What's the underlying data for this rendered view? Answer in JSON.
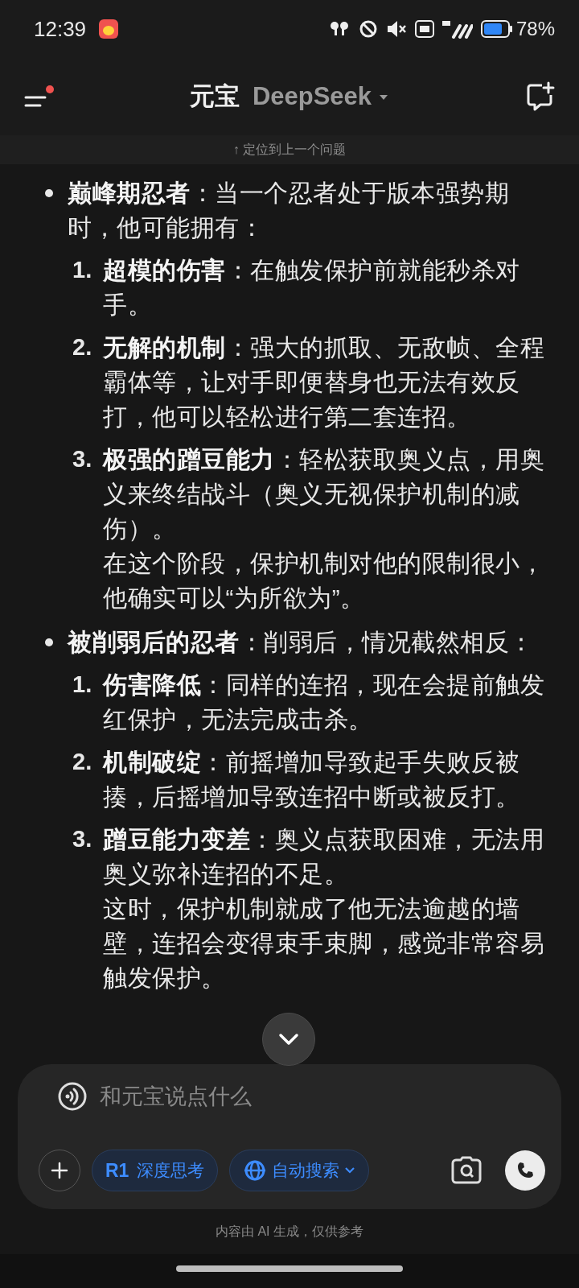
{
  "status_bar": {
    "time": "12:39",
    "battery": "78%"
  },
  "header": {
    "title": "元宝",
    "model": "DeepSeek",
    "notification_dot": true
  },
  "jump_hint": "↑ 定位到上一个问题",
  "content": [
    {
      "text": "**巅峰期忍者**：当一个忍者处于版本强势期时，他可能拥有：",
      "items": [
        {
          "number": "1.",
          "text": "**超模的伤害**：在触发保护前就能秒杀对手。"
        },
        {
          "number": "2.",
          "text": "**无解的机制**：强大的抓取、无敌帧、全程霸体等，让对手即便替身也无法有效反打，他可以轻松进行第二套连招。"
        },
        {
          "number": "3.",
          "text": "**极强的蹭豆能力**：轻松获取奥义点，用奥义来终结战斗（奥义无视保护机制的减伤）。",
          "note": "在这个阶段，保护机制对他的限制很小，他确实可以“为所欲为”。"
        }
      ]
    },
    {
      "text": "**被削弱后的忍者**：削弱后，情况截然相反：",
      "items": [
        {
          "number": "1.",
          "text": "**伤害降低**：同样的连招，现在会提前触发红保护，无法完成击杀。"
        },
        {
          "number": "2.",
          "text": "**机制破绽**：前摇增加导致起手失败反被揍，后摇增加导致连招中断或被反打。"
        },
        {
          "number": "3.",
          "text": "**蹭豆能力变差**：奥义点获取困难，无法用奥义弥补连招的不足。",
          "note": "这时，保护机制就成了他无法逾越的墙壁，连招会变得束手束脚，感觉非常容易触发保护。"
        }
      ]
    }
  ],
  "input": {
    "placeholder": "和元宝说点什么"
  },
  "chips": [
    {
      "kind": "deep-think",
      "prefix": "R1",
      "label": "深度思考",
      "on": true
    },
    {
      "kind": "search",
      "label": "自动搜索",
      "on": true
    }
  ],
  "disclaimer": "内容由 AI 生成，仅供参考"
}
